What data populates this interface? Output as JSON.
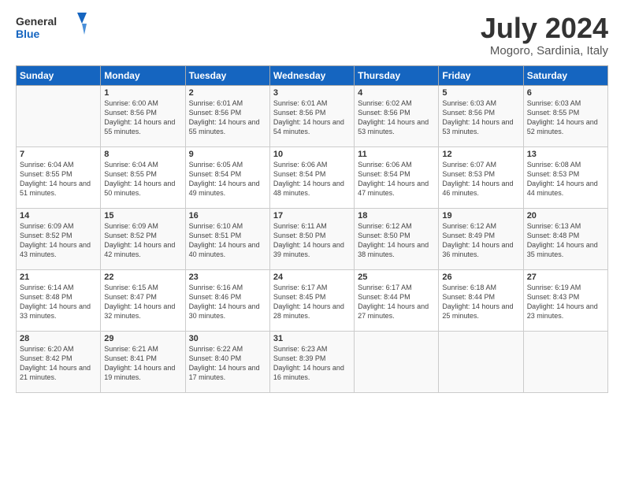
{
  "header": {
    "logo_general": "General",
    "logo_blue": "Blue",
    "title": "July 2024",
    "subtitle": "Mogoro, Sardinia, Italy"
  },
  "days_of_week": [
    "Sunday",
    "Monday",
    "Tuesday",
    "Wednesday",
    "Thursday",
    "Friday",
    "Saturday"
  ],
  "weeks": [
    [
      {
        "day": "",
        "content": ""
      },
      {
        "day": "1",
        "content": "Sunrise: 6:00 AM\nSunset: 8:56 PM\nDaylight: 14 hours\nand 55 minutes."
      },
      {
        "day": "2",
        "content": "Sunrise: 6:01 AM\nSunset: 8:56 PM\nDaylight: 14 hours\nand 55 minutes."
      },
      {
        "day": "3",
        "content": "Sunrise: 6:01 AM\nSunset: 8:56 PM\nDaylight: 14 hours\nand 54 minutes."
      },
      {
        "day": "4",
        "content": "Sunrise: 6:02 AM\nSunset: 8:56 PM\nDaylight: 14 hours\nand 53 minutes."
      },
      {
        "day": "5",
        "content": "Sunrise: 6:03 AM\nSunset: 8:56 PM\nDaylight: 14 hours\nand 53 minutes."
      },
      {
        "day": "6",
        "content": "Sunrise: 6:03 AM\nSunset: 8:55 PM\nDaylight: 14 hours\nand 52 minutes."
      }
    ],
    [
      {
        "day": "7",
        "content": "Sunrise: 6:04 AM\nSunset: 8:55 PM\nDaylight: 14 hours\nand 51 minutes."
      },
      {
        "day": "8",
        "content": "Sunrise: 6:04 AM\nSunset: 8:55 PM\nDaylight: 14 hours\nand 50 minutes."
      },
      {
        "day": "9",
        "content": "Sunrise: 6:05 AM\nSunset: 8:54 PM\nDaylight: 14 hours\nand 49 minutes."
      },
      {
        "day": "10",
        "content": "Sunrise: 6:06 AM\nSunset: 8:54 PM\nDaylight: 14 hours\nand 48 minutes."
      },
      {
        "day": "11",
        "content": "Sunrise: 6:06 AM\nSunset: 8:54 PM\nDaylight: 14 hours\nand 47 minutes."
      },
      {
        "day": "12",
        "content": "Sunrise: 6:07 AM\nSunset: 8:53 PM\nDaylight: 14 hours\nand 46 minutes."
      },
      {
        "day": "13",
        "content": "Sunrise: 6:08 AM\nSunset: 8:53 PM\nDaylight: 14 hours\nand 44 minutes."
      }
    ],
    [
      {
        "day": "14",
        "content": "Sunrise: 6:09 AM\nSunset: 8:52 PM\nDaylight: 14 hours\nand 43 minutes."
      },
      {
        "day": "15",
        "content": "Sunrise: 6:09 AM\nSunset: 8:52 PM\nDaylight: 14 hours\nand 42 minutes."
      },
      {
        "day": "16",
        "content": "Sunrise: 6:10 AM\nSunset: 8:51 PM\nDaylight: 14 hours\nand 40 minutes."
      },
      {
        "day": "17",
        "content": "Sunrise: 6:11 AM\nSunset: 8:50 PM\nDaylight: 14 hours\nand 39 minutes."
      },
      {
        "day": "18",
        "content": "Sunrise: 6:12 AM\nSunset: 8:50 PM\nDaylight: 14 hours\nand 38 minutes."
      },
      {
        "day": "19",
        "content": "Sunrise: 6:12 AM\nSunset: 8:49 PM\nDaylight: 14 hours\nand 36 minutes."
      },
      {
        "day": "20",
        "content": "Sunrise: 6:13 AM\nSunset: 8:48 PM\nDaylight: 14 hours\nand 35 minutes."
      }
    ],
    [
      {
        "day": "21",
        "content": "Sunrise: 6:14 AM\nSunset: 8:48 PM\nDaylight: 14 hours\nand 33 minutes."
      },
      {
        "day": "22",
        "content": "Sunrise: 6:15 AM\nSunset: 8:47 PM\nDaylight: 14 hours\nand 32 minutes."
      },
      {
        "day": "23",
        "content": "Sunrise: 6:16 AM\nSunset: 8:46 PM\nDaylight: 14 hours\nand 30 minutes."
      },
      {
        "day": "24",
        "content": "Sunrise: 6:17 AM\nSunset: 8:45 PM\nDaylight: 14 hours\nand 28 minutes."
      },
      {
        "day": "25",
        "content": "Sunrise: 6:17 AM\nSunset: 8:44 PM\nDaylight: 14 hours\nand 27 minutes."
      },
      {
        "day": "26",
        "content": "Sunrise: 6:18 AM\nSunset: 8:44 PM\nDaylight: 14 hours\nand 25 minutes."
      },
      {
        "day": "27",
        "content": "Sunrise: 6:19 AM\nSunset: 8:43 PM\nDaylight: 14 hours\nand 23 minutes."
      }
    ],
    [
      {
        "day": "28",
        "content": "Sunrise: 6:20 AM\nSunset: 8:42 PM\nDaylight: 14 hours\nand 21 minutes."
      },
      {
        "day": "29",
        "content": "Sunrise: 6:21 AM\nSunset: 8:41 PM\nDaylight: 14 hours\nand 19 minutes."
      },
      {
        "day": "30",
        "content": "Sunrise: 6:22 AM\nSunset: 8:40 PM\nDaylight: 14 hours\nand 17 minutes."
      },
      {
        "day": "31",
        "content": "Sunrise: 6:23 AM\nSunset: 8:39 PM\nDaylight: 14 hours\nand 16 minutes."
      },
      {
        "day": "",
        "content": ""
      },
      {
        "day": "",
        "content": ""
      },
      {
        "day": "",
        "content": ""
      }
    ]
  ]
}
